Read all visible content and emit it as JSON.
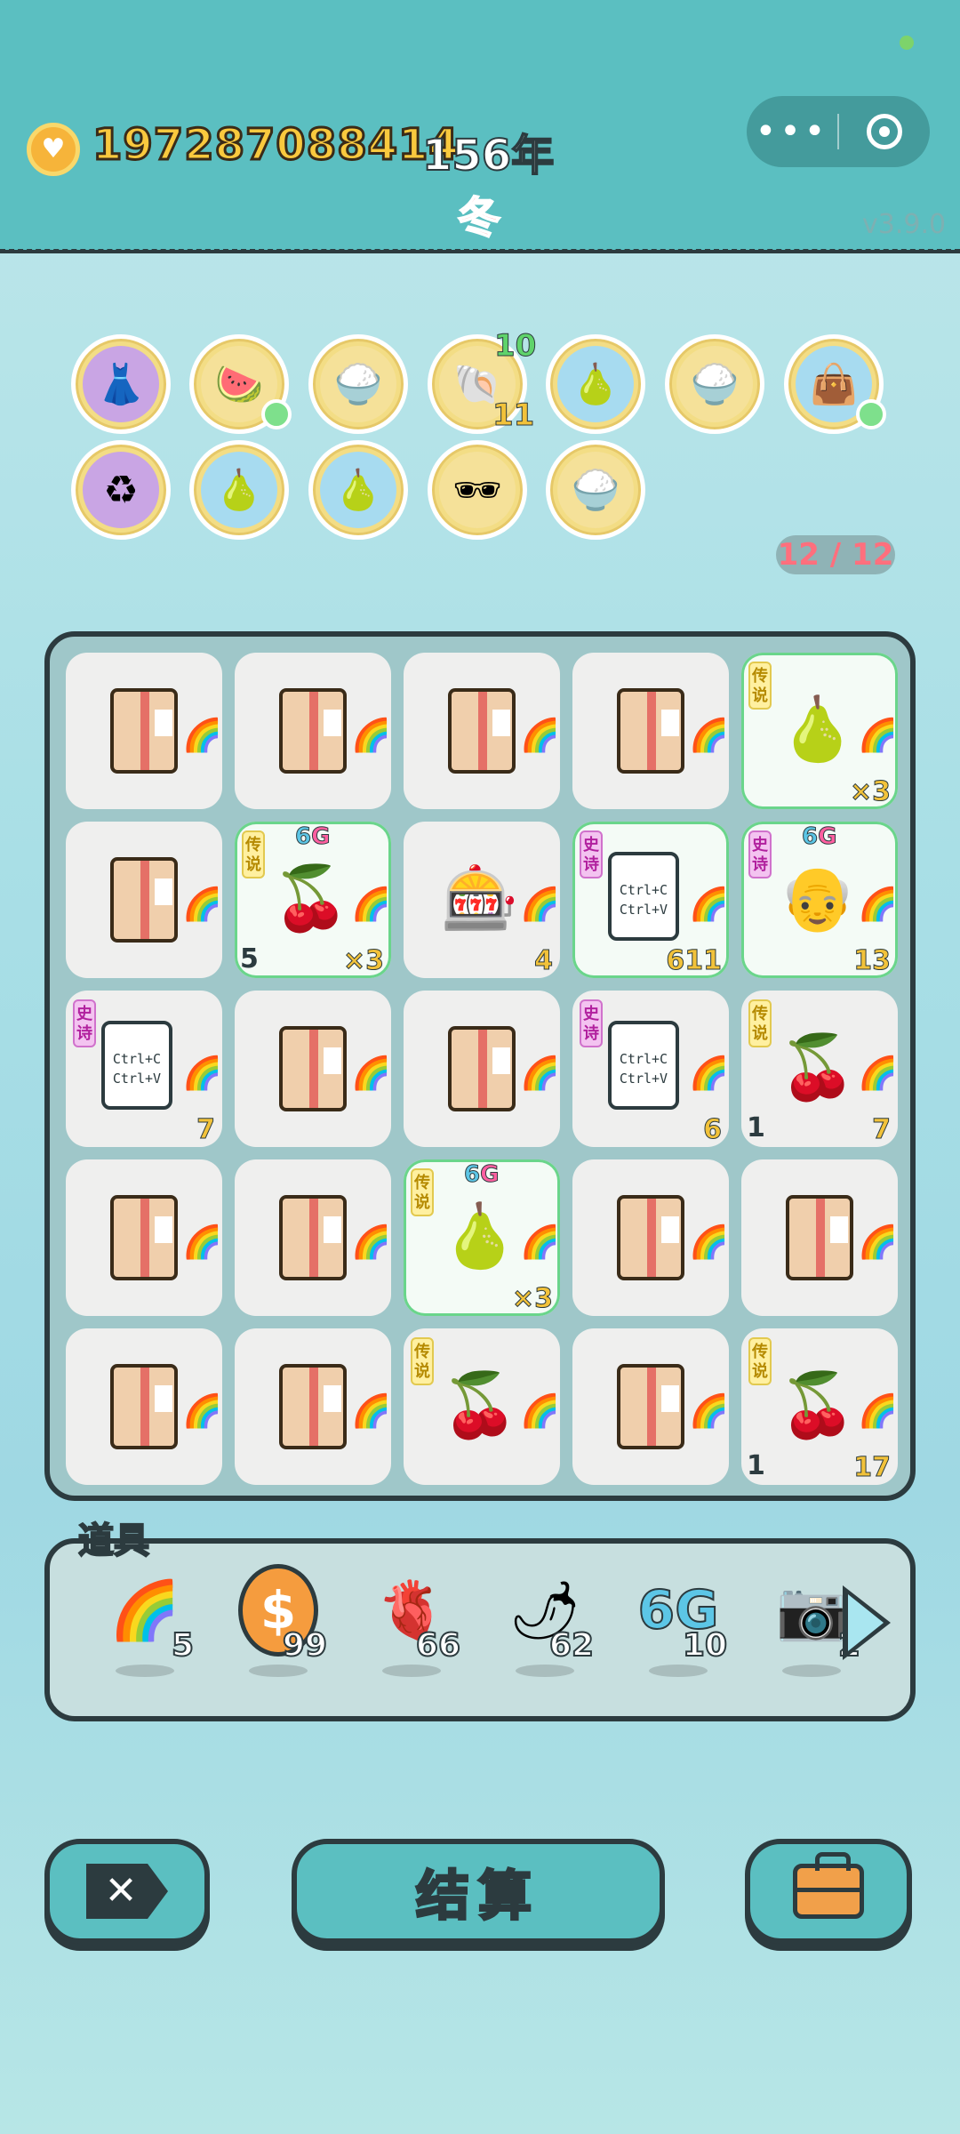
{
  "header": {
    "coins": "197287088414",
    "year": "156年",
    "season": "冬",
    "version": "v3.9.0",
    "capsule_more": "•••"
  },
  "status_effects": [
    {
      "icon": "skirt-icon",
      "glyph": "👗",
      "style": "purple"
    },
    {
      "icon": "fruit-basket-icon",
      "glyph": "🍉",
      "style": "gold",
      "has_dot": true
    },
    {
      "icon": "rice-bowls-icon",
      "glyph": "🍚",
      "style": "gold"
    },
    {
      "icon": "shell-icon",
      "glyph": "🐚",
      "style": "gold",
      "top_num": "10",
      "bottom_num": "11"
    },
    {
      "icon": "pomelo-icon",
      "glyph": "🍐",
      "style": "blue"
    },
    {
      "icon": "rice-bowls-icon",
      "glyph": "🍚",
      "style": "gold"
    },
    {
      "icon": "sack-icon",
      "glyph": "👜",
      "style": "blue",
      "has_dot": true
    },
    {
      "icon": "recycle-icon",
      "glyph": "♻",
      "style": "purple"
    },
    {
      "icon": "pomelo-icon",
      "glyph": "🍐",
      "style": "blue"
    },
    {
      "icon": "pomelo-icon",
      "glyph": "🍐",
      "style": "blue"
    },
    {
      "icon": "sunglasses-fruit-icon",
      "glyph": "🕶",
      "style": "gold"
    },
    {
      "icon": "rice-bowls-icon",
      "glyph": "🍚",
      "style": "gold"
    }
  ],
  "slots": "12 / 12",
  "board": {
    "cells": [
      {
        "type": "box"
      },
      {
        "type": "box"
      },
      {
        "type": "box"
      },
      {
        "type": "box"
      },
      {
        "type": "item",
        "icon": "crowned-pomelo-icon",
        "glyph": "🍐",
        "tag": "legend",
        "tag_text": "传说",
        "count": "×3",
        "rare": true
      },
      {
        "type": "box"
      },
      {
        "type": "item",
        "icon": "longan-icon",
        "glyph": "🍒",
        "tag": "legend",
        "tag_text": "传说",
        "sixg": true,
        "level": "5",
        "count": "×3",
        "rare": true
      },
      {
        "type": "item",
        "icon": "gacha-machine-icon",
        "glyph": "🎰",
        "count": "4"
      },
      {
        "type": "copy",
        "tag": "epic",
        "tag_text": "史诗",
        "count": "611",
        "rare": true
      },
      {
        "type": "item",
        "icon": "king-face-icon",
        "glyph": "👴",
        "tag": "epic",
        "tag_text": "史诗",
        "sixg": true,
        "count": "13",
        "rare": true
      },
      {
        "type": "copy",
        "tag": "epic",
        "tag_text": "史诗",
        "count": "7"
      },
      {
        "type": "box"
      },
      {
        "type": "box"
      },
      {
        "type": "copy",
        "tag": "epic",
        "tag_text": "史诗",
        "count": "6"
      },
      {
        "type": "item",
        "icon": "longan-icon",
        "glyph": "🍒",
        "tag": "legend",
        "tag_text": "传说",
        "level": "1",
        "count": "7"
      },
      {
        "type": "box"
      },
      {
        "type": "box"
      },
      {
        "type": "item",
        "icon": "crowned-pomelo-icon",
        "glyph": "🍐",
        "tag": "legend",
        "tag_text": "传说",
        "sixg": true,
        "count": "×3",
        "rare": true
      },
      {
        "type": "box"
      },
      {
        "type": "box"
      },
      {
        "type": "box"
      },
      {
        "type": "box"
      },
      {
        "type": "item",
        "icon": "longan-icon",
        "glyph": "🍒",
        "tag": "legend",
        "tag_text": "传说"
      },
      {
        "type": "box"
      },
      {
        "type": "item",
        "icon": "longan-icon",
        "glyph": "🍒",
        "tag": "legend",
        "tag_text": "传说",
        "level": "1",
        "count": "17"
      }
    ],
    "copy_text_1": "Ctrl+C",
    "copy_text_2": "Ctrl+V",
    "sixg_text_a": "6",
    "sixg_text_b": "G"
  },
  "tools": {
    "label": "道具",
    "items": [
      {
        "icon": "rainbow-icon",
        "glyph": "🌈",
        "count": "5"
      },
      {
        "icon": "coin-icon",
        "glyph": "$",
        "count": "99"
      },
      {
        "icon": "liver-icon",
        "glyph": "🫀",
        "count": "66"
      },
      {
        "icon": "chili-icon",
        "glyph": "🌶",
        "count": "62"
      },
      {
        "icon": "sixg-icon",
        "glyph": "6G",
        "count": "10"
      },
      {
        "icon": "camera-icon",
        "glyph": "📷",
        "count": "2"
      }
    ]
  },
  "buttons": {
    "close_glyph": "✕",
    "settle_label": "结算"
  }
}
